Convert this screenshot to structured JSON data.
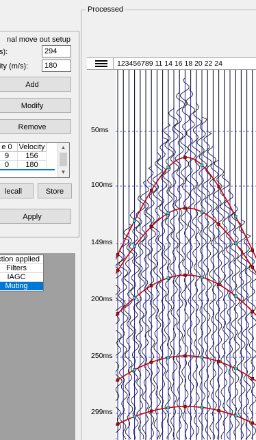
{
  "nmo": {
    "group_label": "nal move out setup",
    "time_label": "s):",
    "time_value": "294",
    "velocity_label": "ity (m/s):",
    "velocity_value": "180",
    "add_label": "Add",
    "modify_label": "Modify",
    "remove_label": "Remove",
    "table": {
      "columns": [
        "e 0",
        "Velocity"
      ],
      "rows": [
        [
          "9",
          "156"
        ],
        [
          "0",
          "180"
        ]
      ]
    },
    "recall_label": "lecall",
    "store_label": "Store",
    "apply_label": "Apply"
  },
  "functions": {
    "header": "nction applied",
    "items": [
      "Filters",
      "IAGC",
      "Muting"
    ],
    "selected": "Muting"
  },
  "processed": {
    "group_label": "Processed",
    "menu_icon": "hamburger-menu-icon",
    "trace_labels": "123456789 11  14 16 18 20 22 24",
    "time_ticks": [
      "50ms",
      "100ms",
      "149ms",
      "200ms",
      "250ms",
      "299ms"
    ],
    "colors": {
      "trace": "#1a1a1a",
      "grid_vertical": "#1c1cc8",
      "grid_horizontal": "#2a2ad0",
      "hyperbola": "#c80000",
      "pick_marker": "#20d0d0",
      "selection": "#0078d7"
    }
  }
}
